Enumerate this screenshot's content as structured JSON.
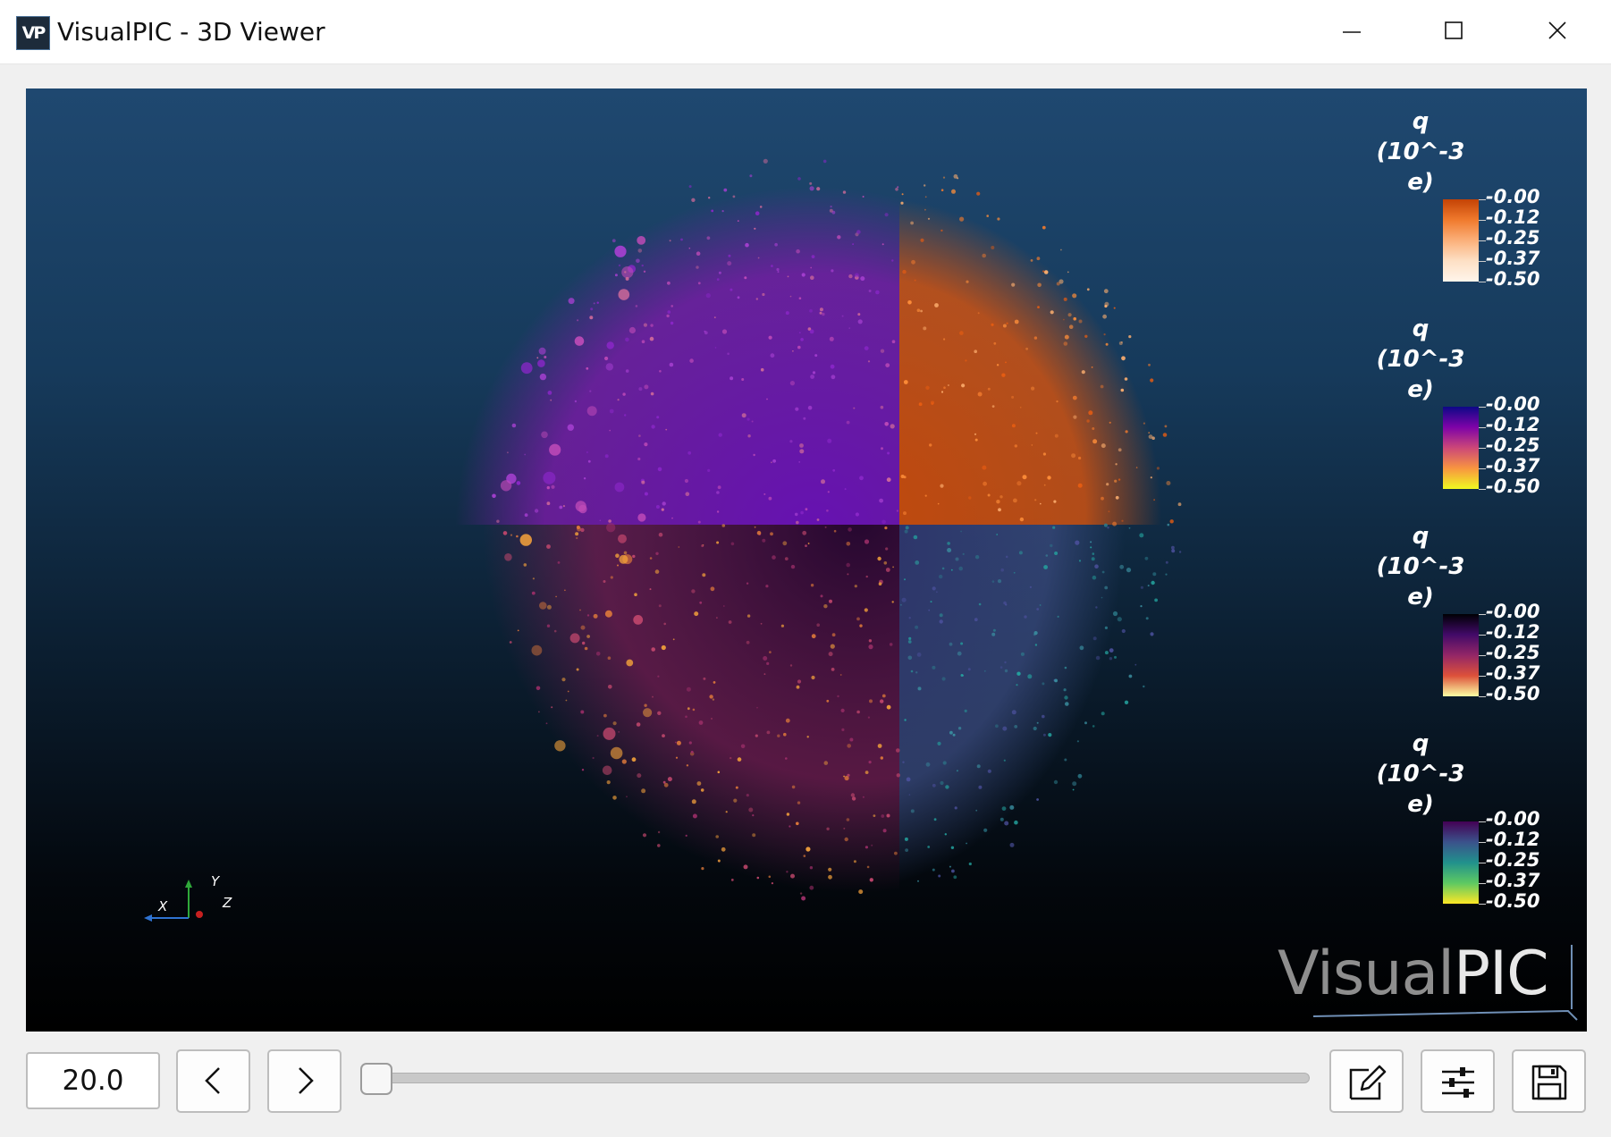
{
  "window": {
    "title": "VisualPIC - 3D Viewer",
    "icon_name": "visualpic-app-icon",
    "icon_text": "VP",
    "controls": [
      "minimize-icon",
      "maximize-icon",
      "close-icon"
    ]
  },
  "viewer": {
    "background_top": "#1f4870",
    "background_bottom": "#000000",
    "quadrant_colors": {
      "top_left": "#7a1ba8",
      "top_right": "#d9540e",
      "bottom_left": "#4a0f3e",
      "bottom_right": "#3a3f7e"
    },
    "legends": [
      {
        "title": [
          "q",
          "(10^-3",
          "e)"
        ],
        "ticks": [
          "-0.00",
          "-0.12",
          "-0.25",
          "-0.37",
          "-0.50"
        ],
        "colormap": "oranges",
        "colors": [
          "#c44305",
          "#f07a2d",
          "#fbb07a",
          "#fde0c5",
          "#fff5eb"
        ]
      },
      {
        "title": [
          "q",
          "(10^-3",
          "e)"
        ],
        "ticks": [
          "-0.00",
          "-0.12",
          "-0.25",
          "-0.37",
          "-0.50"
        ],
        "colormap": "plasma",
        "colors": [
          "#0d0887",
          "#7e03a8",
          "#cc4778",
          "#f89540",
          "#f0f921"
        ]
      },
      {
        "title": [
          "q",
          "(10^-3",
          "e)"
        ],
        "ticks": [
          "-0.00",
          "-0.12",
          "-0.25",
          "-0.37",
          "-0.50"
        ],
        "colormap": "inferno",
        "colors": [
          "#000004",
          "#420a68",
          "#932667",
          "#dd513a",
          "#fcffa4"
        ]
      },
      {
        "title": [
          "q",
          "(10^-3",
          "e)"
        ],
        "ticks": [
          "-0.00",
          "-0.12",
          "-0.25",
          "-0.37",
          "-0.50"
        ],
        "colormap": "viridis",
        "colors": [
          "#440154",
          "#3b528b",
          "#21918c",
          "#5ec962",
          "#fde725"
        ]
      }
    ],
    "axes": {
      "x": "X",
      "y": "Y",
      "z": "Z",
      "x_color": "#2f73d1",
      "y_color": "#2fa83a",
      "z_color": "#c62020"
    },
    "watermark": {
      "light": "Visual",
      "bold": "PIC"
    }
  },
  "controls": {
    "time_value": "20.0",
    "prev_icon": "chevron-left-icon",
    "next_icon": "chevron-right-icon",
    "slider_fraction": 0.0,
    "edit_icon": "edit-icon",
    "settings_icon": "sliders-icon",
    "save_icon": "save-icon"
  }
}
